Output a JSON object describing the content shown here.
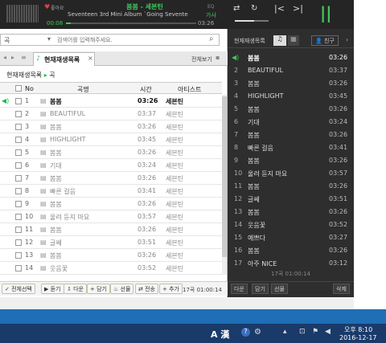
{
  "player": {
    "like_label": "좋아요",
    "song_title": "봄봄 - 세븐틴",
    "album": "Seventeen 3rd Mini Album `Going Sevente",
    "eq_label": "EQ",
    "lyrics_label": "가사",
    "time_current": "00:08",
    "time_total": "03:26",
    "progress": 0.04,
    "accent": "#1db954"
  },
  "search": {
    "value": "곡",
    "placeholder": "검색어를 입력해주세요."
  },
  "tabs": {
    "active": "현재재생목록",
    "full_view": "전체보기"
  },
  "breadcrumb": {
    "root": "현재재생목록",
    "leaf": "곡"
  },
  "table": {
    "headers": {
      "no": "No",
      "title": "곡명",
      "time": "시간",
      "artist": "아티스트"
    },
    "rows": [
      {
        "no": "1",
        "title": "봄봄",
        "time": "03:26",
        "artist": "세븐틴",
        "playing": true
      },
      {
        "no": "2",
        "title": "BEAUTIFUL",
        "time": "03:37",
        "artist": "세븐틴"
      },
      {
        "no": "3",
        "title": "봄봄",
        "time": "03:26",
        "artist": "세븐틴"
      },
      {
        "no": "4",
        "title": "HIGHLIGHT",
        "time": "03:45",
        "artist": "세븐틴"
      },
      {
        "no": "5",
        "title": "봄봄",
        "time": "03:26",
        "artist": "세븐틴"
      },
      {
        "no": "6",
        "title": "기대",
        "time": "03:24",
        "artist": "세븐틴"
      },
      {
        "no": "7",
        "title": "봄봄",
        "time": "03:26",
        "artist": "세븐틴"
      },
      {
        "no": "8",
        "title": "빠른 걸음",
        "time": "03:41",
        "artist": "세븐틴"
      },
      {
        "no": "9",
        "title": "봄봄",
        "time": "03:26",
        "artist": "세븐틴"
      },
      {
        "no": "10",
        "title": "울려 듣지 마요",
        "time": "03:57",
        "artist": "세븐틴"
      },
      {
        "no": "11",
        "title": "봄봄",
        "time": "03:26",
        "artist": "세븐틴"
      },
      {
        "no": "12",
        "title": "글쎄",
        "time": "03:51",
        "artist": "세븐틴"
      },
      {
        "no": "13",
        "title": "봄봄",
        "time": "03:26",
        "artist": "세븐틴"
      },
      {
        "no": "14",
        "title": "웃음꽃",
        "time": "03:52",
        "artist": "세븐틴"
      }
    ]
  },
  "bottom_bar": {
    "select_all": "전체선택",
    "listen": "듣기",
    "download": "다운",
    "add": "담기",
    "gift": "선물",
    "share": "전송",
    "more": "추가",
    "summary": "17곡 01:00:14"
  },
  "right_panel": {
    "header": "현재재생목록",
    "friend": "친구",
    "rows": [
      {
        "no": "",
        "title": "봄봄",
        "time": "03:26",
        "playing": true
      },
      {
        "no": "2",
        "title": "BEAUTIFUL",
        "time": "03:37"
      },
      {
        "no": "3",
        "title": "봄봄",
        "time": "03:26"
      },
      {
        "no": "4",
        "title": "HIGHLIGHT",
        "time": "03:45"
      },
      {
        "no": "5",
        "title": "봄봄",
        "time": "03:26"
      },
      {
        "no": "6",
        "title": "기대",
        "time": "03:24"
      },
      {
        "no": "7",
        "title": "봄봄",
        "time": "03:26"
      },
      {
        "no": "8",
        "title": "빠른 걸음",
        "time": "03:41"
      },
      {
        "no": "9",
        "title": "봄봄",
        "time": "03:26"
      },
      {
        "no": "10",
        "title": "울려 듣지 마요",
        "time": "03:57"
      },
      {
        "no": "11",
        "title": "봄봄",
        "time": "03:26"
      },
      {
        "no": "12",
        "title": "글쎄",
        "time": "03:51"
      },
      {
        "no": "13",
        "title": "봄봄",
        "time": "03:26"
      },
      {
        "no": "14",
        "title": "웃음꽃",
        "time": "03:52"
      },
      {
        "no": "15",
        "title": "예쁘다",
        "time": "03:27"
      },
      {
        "no": "16",
        "title": "봄봄",
        "time": "03:26"
      },
      {
        "no": "17",
        "title": "아주 NICE",
        "time": "03:12"
      }
    ],
    "summary": "17곡 01:00:14",
    "btn_listen": "다운",
    "btn_add": "담기",
    "btn_gift": "선물",
    "btn_delete": "삭제"
  },
  "taskbar": {
    "ime": "A 漢",
    "time": "오후 8:10",
    "date": "2016-12-17"
  }
}
